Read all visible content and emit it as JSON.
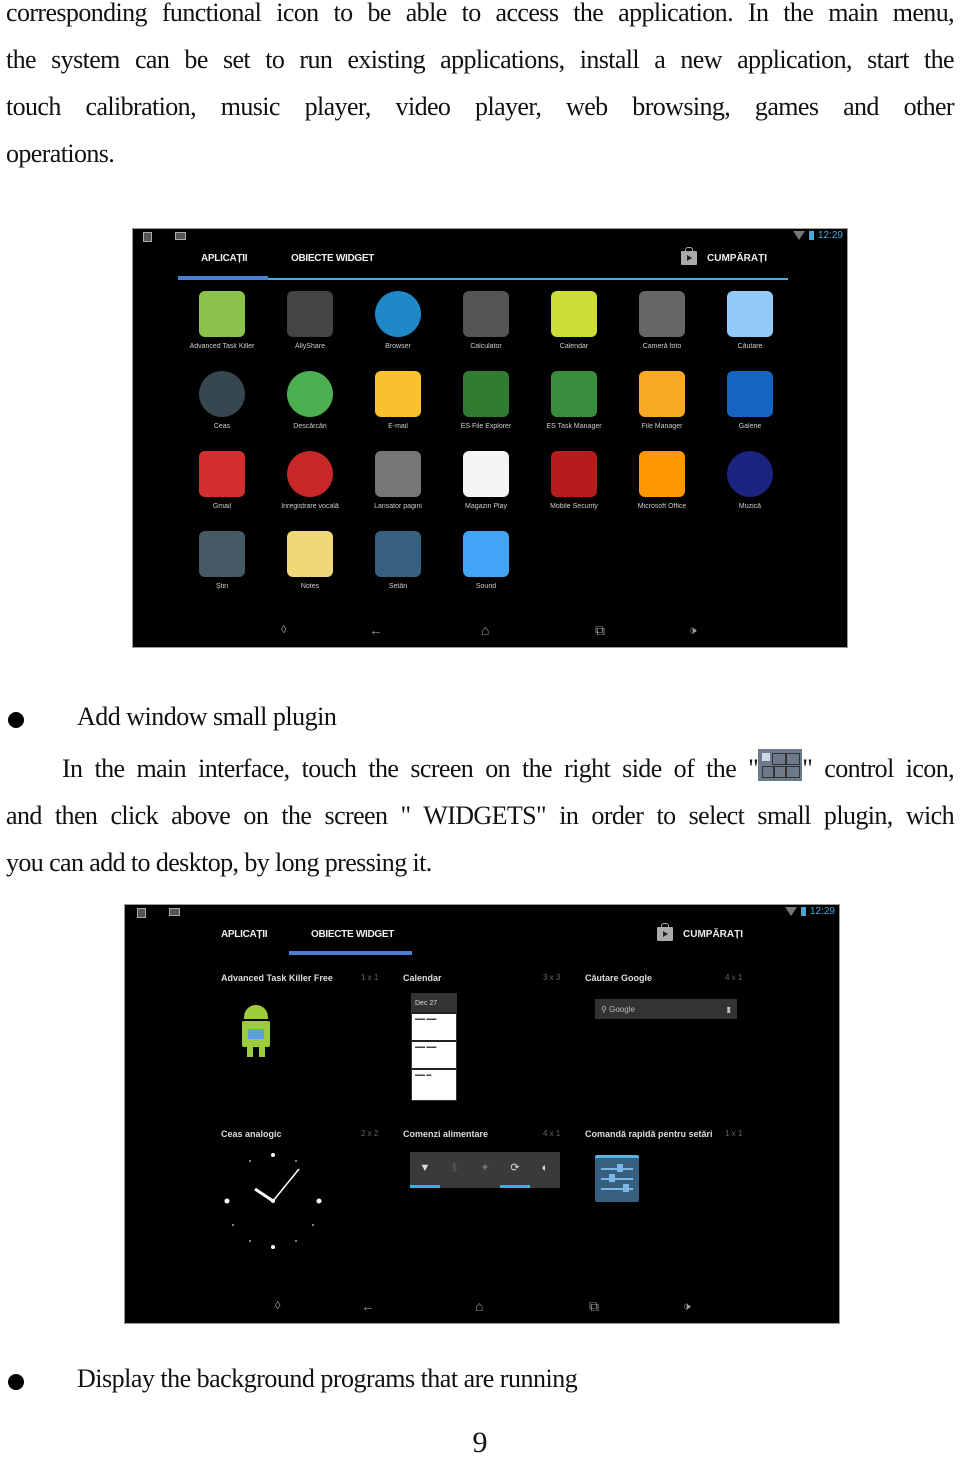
{
  "intro": {
    "lines": [
      "corresponding functional icon to be able to access the application. In the main menu,",
      "the system can be set to run existing applications, install a new application, start the",
      "touch calibration, music player, video player, web browsing, games and other",
      "operations."
    ]
  },
  "screen1": {
    "status": {
      "time": "12:29"
    },
    "tabs": [
      {
        "label": "APLICAȚII",
        "active": true
      },
      {
        "label": "OBIECTE WIDGET",
        "active": false
      }
    ],
    "shop_label": "CUMPĂRAȚI",
    "apps": [
      {
        "label": "Advanced Task Killer",
        "icon": "task-killer-icon",
        "color": "#8bc34a"
      },
      {
        "label": "AllyShare",
        "icon": "allshare-icon",
        "color": "#444444"
      },
      {
        "label": "Browser",
        "icon": "globe-icon",
        "color": "#1e88c8"
      },
      {
        "label": "Calculator",
        "icon": "calculator-icon",
        "color": "#555555"
      },
      {
        "label": "Calendar",
        "icon": "calendar-icon",
        "color": "#cddc39"
      },
      {
        "label": "Cameră foto",
        "icon": "camera-icon",
        "color": "#666666"
      },
      {
        "label": "Căutare",
        "icon": "magnifier-icon",
        "color": "#90caf9"
      },
      {
        "label": "Ceas",
        "icon": "clock-icon",
        "color": "#37474f"
      },
      {
        "label": "Descărcări",
        "icon": "download-icon",
        "color": "#4caf50"
      },
      {
        "label": "E-mail",
        "icon": "email-icon",
        "color": "#fbc02d"
      },
      {
        "label": "ES File Explorer",
        "icon": "es-file-explorer-icon",
        "color": "#2e7d32"
      },
      {
        "label": "ES Task Manager",
        "icon": "es-task-manager-icon",
        "color": "#388e3c"
      },
      {
        "label": "File Manager",
        "icon": "folder-icon",
        "color": "#f9a825"
      },
      {
        "label": "Galerie",
        "icon": "gallery-icon",
        "color": "#1565c0"
      },
      {
        "label": "Gmail",
        "icon": "gmail-icon",
        "color": "#d32f2f"
      },
      {
        "label": "Înregistrare vocală",
        "icon": "microphone-icon",
        "color": "#c62828"
      },
      {
        "label": "Lansator pagini",
        "icon": "pages-icon",
        "color": "#777777"
      },
      {
        "label": "Magazin Play",
        "icon": "play-store-icon",
        "color": "#f5f5f5"
      },
      {
        "label": "Mobile Security",
        "icon": "security-b-icon",
        "color": "#b71c1c"
      },
      {
        "label": "Microsoft Office",
        "icon": "office-icon",
        "color": "#ff9800"
      },
      {
        "label": "Muzică",
        "icon": "speaker-icon",
        "color": "#1a237e"
      },
      {
        "label": "Știri",
        "icon": "news-icon",
        "color": "#455a64"
      },
      {
        "label": "Notes",
        "icon": "notes-icon",
        "color": "#f0d878"
      },
      {
        "label": "Setări",
        "icon": "settings-icon",
        "color": "#37607e"
      },
      {
        "label": "Sound",
        "icon": "sound-icon",
        "color": "#42a5f5"
      }
    ]
  },
  "instructions": {
    "bullet1": "Add window small plugin",
    "para_line1_before": "In the main interface, touch the screen on the right side of the \"",
    "para_line1_after": "\" control icon,",
    "para_lines": [
      "and then click above  on the screen \" WIDGETS\" in order to select small plugin, wich",
      "you can add to desktop, by long pressing it."
    ]
  },
  "screen2": {
    "status": {
      "time": "12:29"
    },
    "tabs": [
      {
        "label": "APLICAȚII",
        "active": false
      },
      {
        "label": "OBIECTE WIDGET",
        "active": true
      }
    ],
    "shop_label": "CUMPĂRAȚI",
    "widgets": [
      {
        "name": "Advanced Task Killer Free",
        "size": "1 x 1"
      },
      {
        "name": "Calendar",
        "size": "3 x 3"
      },
      {
        "name": "Căutare Google",
        "size": "4 x 1"
      },
      {
        "name": "Ceas analogic",
        "size": "2 x 2"
      },
      {
        "name": "Comenzi alimentare",
        "size": "4 x 1"
      },
      {
        "name": "Comandă rapidă pentru setări",
        "size": "1 x 1"
      }
    ],
    "calendar_date": "Dec 27",
    "search_hint": "Google"
  },
  "bullet2": "Display the background programs that are running",
  "page_number": "9",
  "colors": {
    "accent": "#33b5e5",
    "active_tab": "#4a7fd4"
  }
}
